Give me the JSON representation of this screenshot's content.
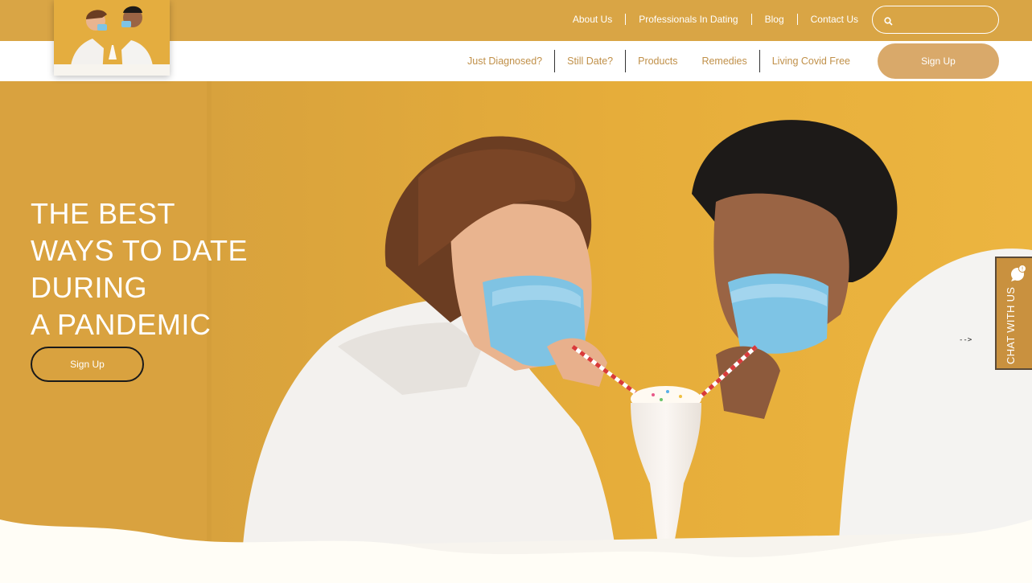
{
  "top_nav": {
    "links": [
      "About Us",
      "Professionals In Dating",
      "Blog",
      "Contact Us"
    ],
    "search": {
      "placeholder": "",
      "icon": "search-icon"
    }
  },
  "main_nav": {
    "links": [
      "Just Diagnosed?",
      "Still Date?",
      "Products",
      "Remedies",
      "Living Covid Free"
    ],
    "signup_label": "Sign Up"
  },
  "hero": {
    "title_lines": [
      "THE BEST",
      "WAYS TO DATE",
      "DURING",
      "A PANDEMIC"
    ],
    "signup_label": "Sign Up"
  },
  "chat": {
    "label": "CHAT WITH US",
    "icon": "chat-bubble-icon",
    "arrow": "-->"
  },
  "colors": {
    "brand": "#d9a545",
    "nav_text": "#c09049",
    "signup_button": "#d9a96a",
    "background": "#fffdf6"
  }
}
